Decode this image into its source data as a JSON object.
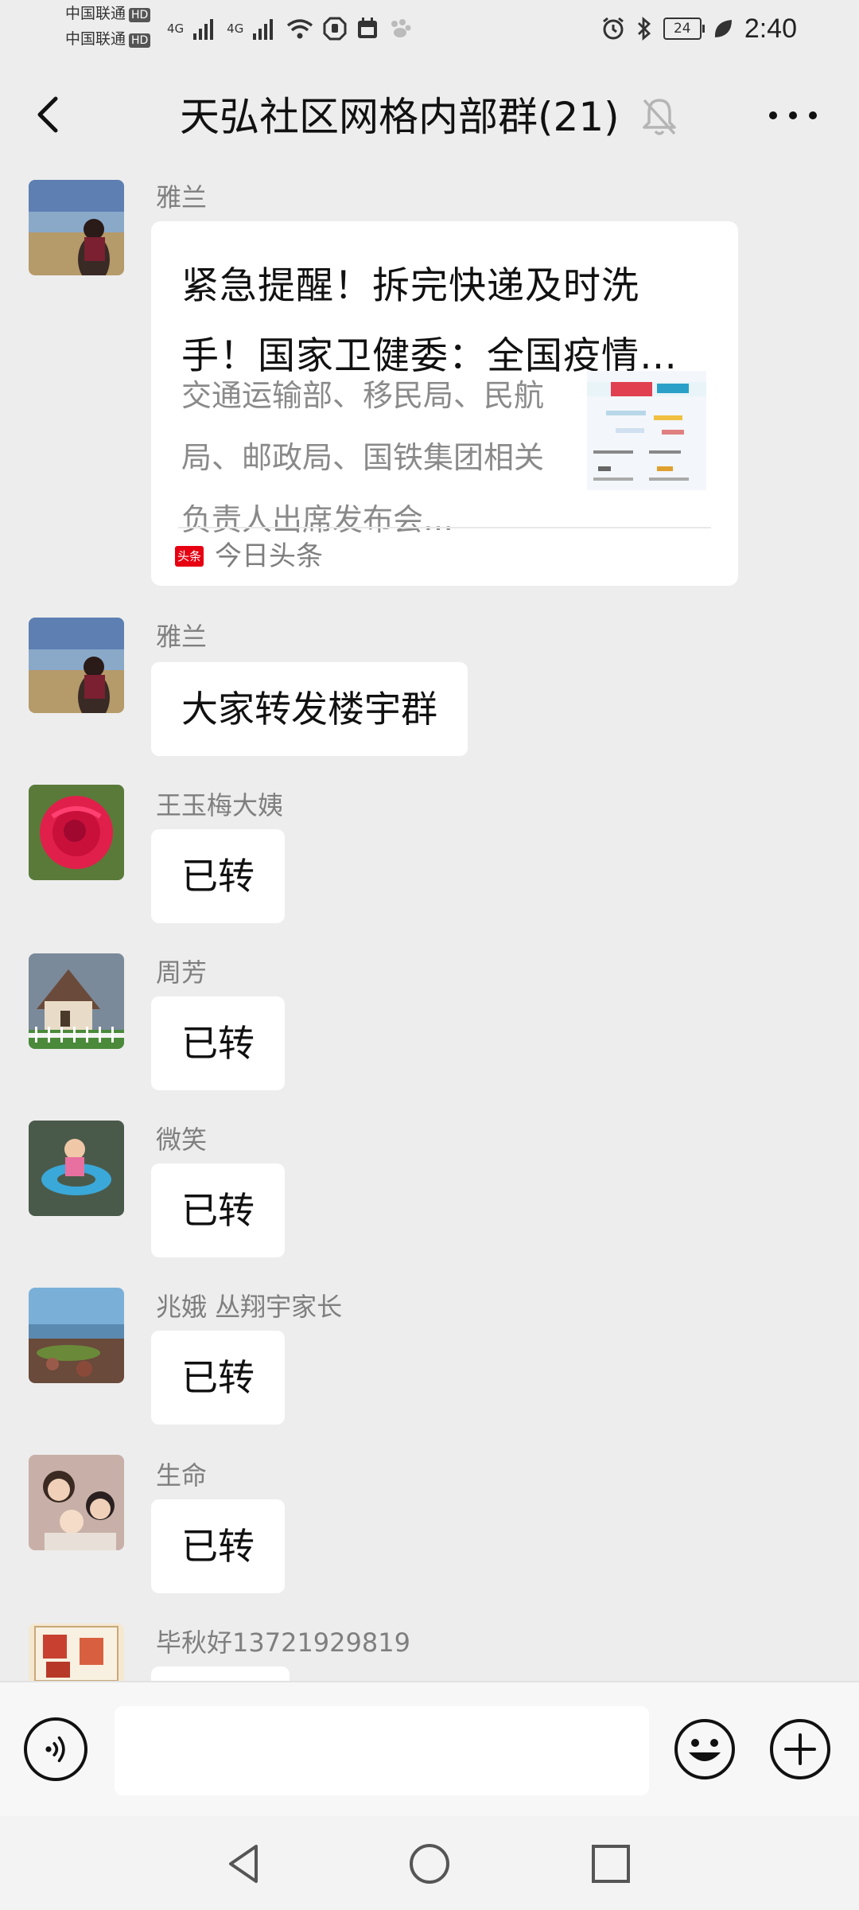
{
  "status_bar": {
    "carrier_1": "中国联通",
    "carrier_2": "中国联通",
    "hd": "HD",
    "network_1": "4G",
    "network_2": "4G",
    "battery": "24",
    "time": "2:40"
  },
  "header": {
    "title": "天弘社区网格内部群(21)"
  },
  "messages": [
    {
      "sender": "雅兰",
      "type": "link_card",
      "card": {
        "title": "紧急提醒！拆完快递及时洗手！国家卫健委：全国疫情…",
        "description": "交通运输部、移民局、民航局、邮政局、国铁集团相关负责人出席发布会…",
        "source_badge": "头条",
        "source": "今日头条"
      }
    },
    {
      "sender": "雅兰",
      "text": "大家转发楼宇群"
    },
    {
      "sender": "王玉梅大姨",
      "text": "已转"
    },
    {
      "sender": "周芳",
      "text": "已转"
    },
    {
      "sender": "微笑",
      "text": "已转"
    },
    {
      "sender": "兆娥 丛翔宇家长",
      "text": "已转"
    },
    {
      "sender": "生命",
      "text": "已转"
    },
    {
      "sender": "毕秋好13721929819",
      "text": ""
    }
  ],
  "input": {
    "value": "",
    "placeholder": ""
  },
  "colors": {
    "background": "#ededed",
    "bubble": "#ffffff",
    "source_badge": "#e60012"
  }
}
